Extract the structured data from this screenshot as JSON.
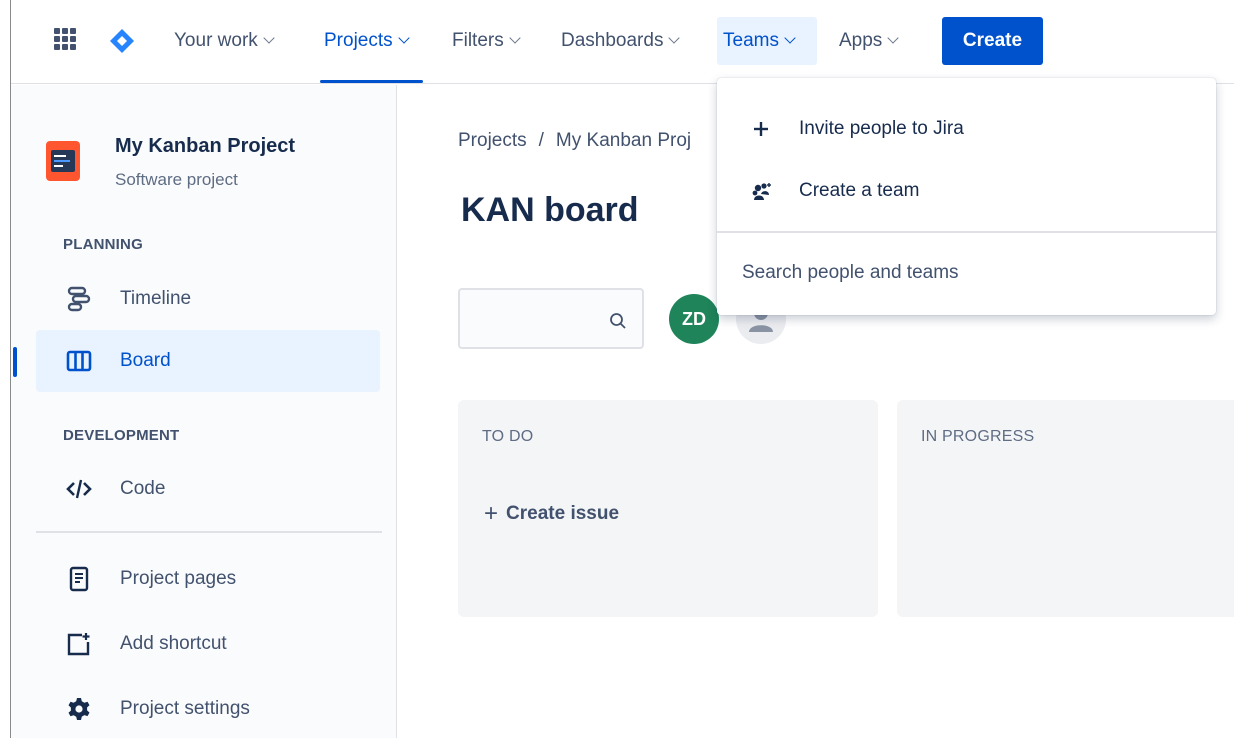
{
  "nav": {
    "items": [
      {
        "label": "Your work"
      },
      {
        "label": "Projects"
      },
      {
        "label": "Filters"
      },
      {
        "label": "Dashboards"
      },
      {
        "label": "Teams"
      },
      {
        "label": "Apps"
      }
    ],
    "active": "Projects",
    "open_menu": "Teams",
    "create_label": "Create",
    "colors": {
      "accent": "#0052cc",
      "logo": "#2684ff"
    }
  },
  "sidebar": {
    "project_name": "My Kanban Project",
    "project_type": "Software project",
    "sections": {
      "planning": "PLANNING",
      "development": "DEVELOPMENT"
    },
    "items": [
      {
        "label": "Timeline",
        "icon": "timeline-icon"
      },
      {
        "label": "Board",
        "icon": "board-icon",
        "selected": true
      },
      {
        "label": "Code",
        "icon": "code-icon"
      },
      {
        "label": "Project pages",
        "icon": "page-icon"
      },
      {
        "label": "Add shortcut",
        "icon": "add-shortcut-icon"
      },
      {
        "label": "Project settings",
        "icon": "gear-icon"
      }
    ]
  },
  "main": {
    "breadcrumb": {
      "root": "Projects",
      "separator": "/",
      "current": "My Kanban Proj"
    },
    "board_title": "KAN board",
    "search": {
      "placeholder": "",
      "icon": "search-icon"
    },
    "avatar_initials": "ZD",
    "columns": [
      {
        "title": "TO DO",
        "create_label": "Create issue"
      },
      {
        "title": "IN PROGRESS"
      }
    ]
  },
  "teams_menu": {
    "items": [
      {
        "label": "Invite people to Jira",
        "icon": "plus-icon"
      },
      {
        "label": "Create a team",
        "icon": "team-icon"
      }
    ],
    "search_label": "Search people and teams"
  }
}
